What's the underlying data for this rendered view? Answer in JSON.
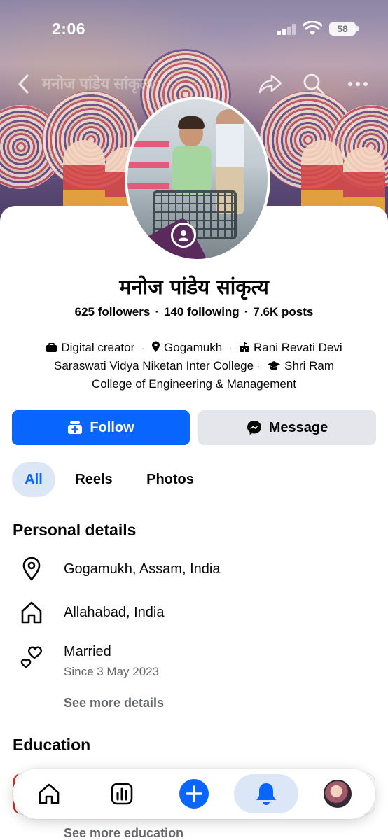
{
  "status_bar": {
    "time": "2:06",
    "battery": "58"
  },
  "header": {
    "cover_title": "मनोज पांडेय सांकृत्य"
  },
  "profile": {
    "name": "मनोज पांडेय सांकृत्य",
    "followers": "625 followers",
    "following": "140 following",
    "posts": "7.6K posts",
    "separator": "·"
  },
  "bio": {
    "role": "Digital creator",
    "location": "Gogamukh",
    "school_line1": "Rani Revati Devi",
    "school_line2": "Saraswati Vidya Niketan Inter College",
    "college_line1": "Shri Ram",
    "college_line2": "College of Engineering & Management",
    "separator": "·"
  },
  "actions": {
    "follow_label": "Follow",
    "message_label": "Message"
  },
  "tabs": [
    {
      "label": "All"
    },
    {
      "label": "Reels"
    },
    {
      "label": "Photos"
    }
  ],
  "personal_details": {
    "title": "Personal details",
    "items": [
      {
        "icon": "location-pin-icon",
        "text": "Gogamukh, Assam, India"
      },
      {
        "icon": "home-icon",
        "text": "Allahabad, India"
      },
      {
        "icon": "hearts-icon",
        "text": "Married",
        "subtext": "Since 3 May 2023"
      }
    ],
    "see_more": "See more details"
  },
  "education": {
    "title": "Education",
    "see_more": "See more education"
  },
  "bottom_nav": {
    "items": [
      {
        "icon": "home-icon"
      },
      {
        "icon": "dashboard-icon"
      },
      {
        "icon": "create-plus-icon"
      },
      {
        "icon": "notifications-bell-icon",
        "active": true
      },
      {
        "icon": "profile-avatar-icon"
      }
    ]
  },
  "colors": {
    "brand_blue": "#0866ff",
    "secondary_button": "#e4e6eb",
    "tab_active_bg": "#dbe7f7",
    "muted_text": "#65676b"
  }
}
